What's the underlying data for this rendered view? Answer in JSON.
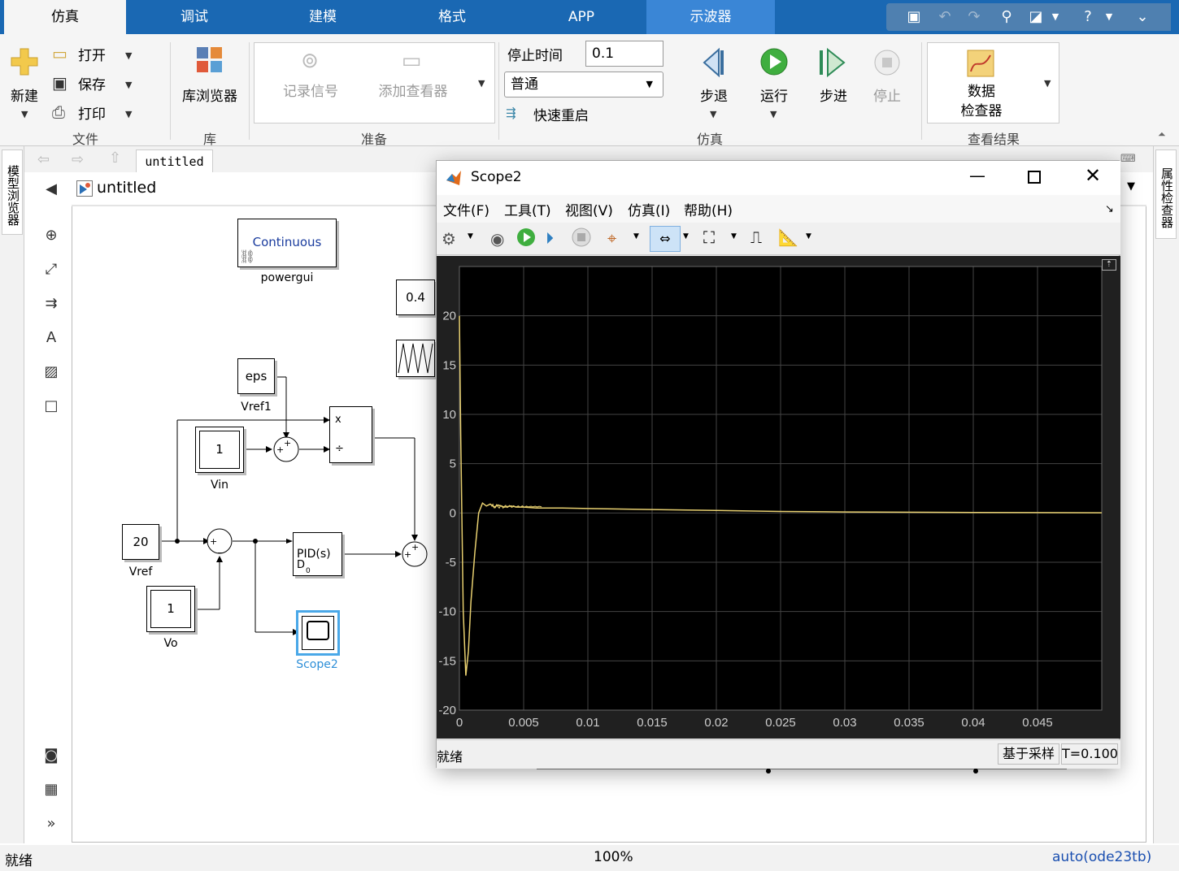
{
  "tabs": [
    "仿真",
    "调试",
    "建模",
    "格式",
    "APP",
    "示波器"
  ],
  "ribbon": {
    "file": {
      "new": "新建",
      "open": "打开",
      "save": "保存",
      "print": "打印",
      "group": "文件"
    },
    "library": {
      "browser": "库浏览器",
      "group": "库"
    },
    "prepare": {
      "log": "记录信号",
      "add_viewer": "添加查看器",
      "group": "准备"
    },
    "simulate": {
      "stop_time_label": "停止时间",
      "stop_time": "0.1",
      "mode": "普通",
      "fast_restart": "快速重启",
      "step_back": "步退",
      "run": "运行",
      "step_forward": "步进",
      "stop": "停止",
      "group": "仿真"
    },
    "review": {
      "data_inspector_1": "数据",
      "data_inspector_2": "检查器",
      "group": "查看结果"
    }
  },
  "left_panel": "模型浏览器",
  "right_panel": "属性检查器",
  "breadcrumb": "untitled",
  "model_title": "untitled",
  "blocks": {
    "powergui": {
      "text": "Continuous",
      "label": "powergui"
    },
    "const04": "0.4",
    "eps": {
      "text": "eps",
      "label": "Vref1"
    },
    "vin": {
      "text": "1",
      "label": "Vin"
    },
    "vref": {
      "text": "20",
      "label": "Vref"
    },
    "vo": {
      "text": "1",
      "label": "Vo"
    },
    "pid": {
      "text": "PID(s)",
      "sub": "D",
      "sub2": "0"
    },
    "product": {
      "x": "x",
      "div": "÷"
    },
    "scope": {
      "label": "Scope2"
    }
  },
  "status": {
    "left": "就绪",
    "zoom": "100%",
    "solver": "auto(ode23tb)"
  },
  "scope_window": {
    "title": "Scope2",
    "menu": [
      "文件(F)",
      "工具(T)",
      "视图(V)",
      "仿真(I)",
      "帮助(H)"
    ],
    "status_left": "就绪",
    "status_mode": "基于采样",
    "status_time": "T=0.100"
  },
  "chart_data": {
    "type": "line",
    "title": "",
    "xlabel": "",
    "ylabel": "",
    "xlim": [
      0,
      0.05
    ],
    "ylim": [
      -20,
      25
    ],
    "xticks": [
      "0",
      "0.005",
      "0.01",
      "0.015",
      "0.02",
      "0.025",
      "0.03",
      "0.035",
      "0.04",
      "0.045"
    ],
    "yticks": [
      "20",
      "15",
      "10",
      "5",
      "0",
      "-5",
      "-10",
      "-15",
      "-20"
    ],
    "grid": true,
    "series": [
      {
        "color": "#e8d070",
        "x": [
          0,
          0.0001,
          0.0003,
          0.0005,
          0.0007,
          0.0009,
          0.0012,
          0.0015,
          0.0018,
          0.0021,
          0.0024,
          0.0027,
          0.003,
          0.0035,
          0.004,
          0.0045,
          0.005,
          0.006,
          0.008,
          0.01,
          0.015,
          0.02,
          0.025,
          0.03,
          0.04,
          0.05
        ],
        "y": [
          20,
          8,
          -10,
          -16.5,
          -14,
          -9,
          -4,
          0,
          1,
          0.7,
          0.9,
          0.6,
          0.8,
          0.6,
          0.7,
          0.6,
          0.6,
          0.5,
          0.5,
          0.45,
          0.35,
          0.25,
          0.15,
          0.1,
          0.05,
          0.02
        ]
      }
    ]
  }
}
